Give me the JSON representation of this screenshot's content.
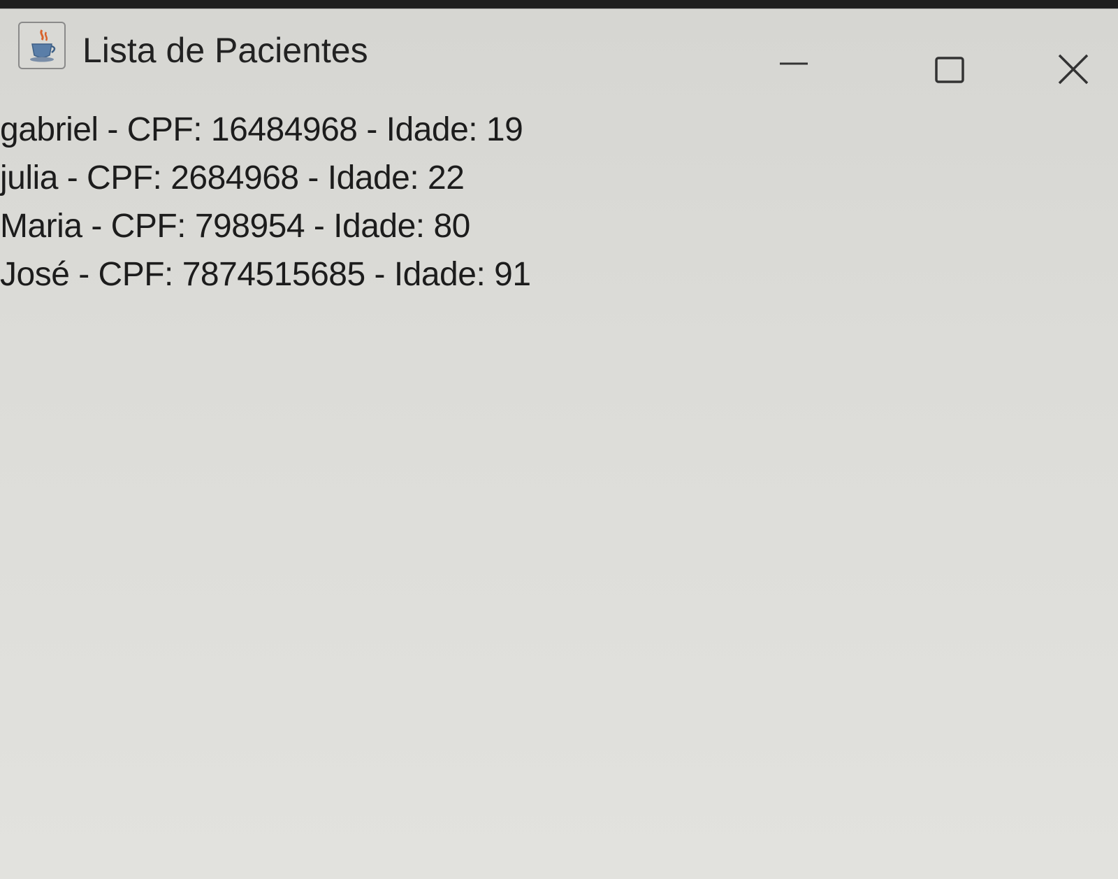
{
  "window": {
    "title": "Lista de Pacientes",
    "icon": "java-cup-icon",
    "controls": {
      "minimize": "minimize-icon",
      "maximize": "maximize-icon",
      "close": "close-icon"
    }
  },
  "patients": [
    {
      "text": "gabriel - CPF: 16484968 - Idade: 19"
    },
    {
      "text": "julia - CPF: 2684968 - Idade: 22"
    },
    {
      "text": "Maria - CPF: 798954 - Idade: 80"
    },
    {
      "text": "José - CPF: 7874515685 - Idade: 91"
    }
  ]
}
